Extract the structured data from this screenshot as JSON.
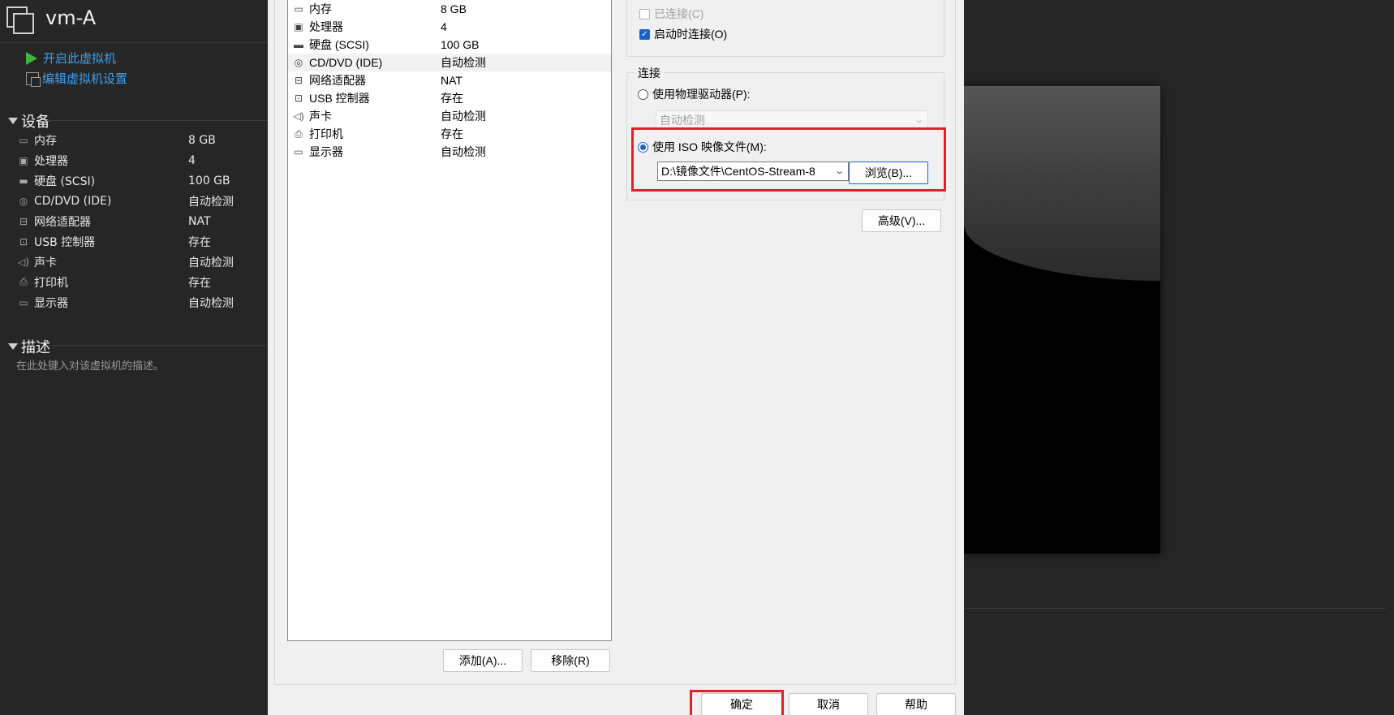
{
  "vm": {
    "title": "vm-A",
    "actions": {
      "power_on": "开启此虚拟机",
      "edit_settings": "编辑虚拟机设置"
    },
    "devices_heading": "设备",
    "devices": [
      {
        "icon": "memory-icon",
        "name": "内存",
        "value": "8 GB"
      },
      {
        "icon": "processor-icon",
        "name": "处理器",
        "value": "4"
      },
      {
        "icon": "harddisk-icon",
        "name": "硬盘 (SCSI)",
        "value": "100 GB"
      },
      {
        "icon": "cd-dvd-icon",
        "name": "CD/DVD (IDE)",
        "value": "自动检测"
      },
      {
        "icon": "network-icon",
        "name": "网络适配器",
        "value": "NAT"
      },
      {
        "icon": "usb-icon",
        "name": "USB 控制器",
        "value": "存在"
      },
      {
        "icon": "sound-icon",
        "name": "声卡",
        "value": "自动检测"
      },
      {
        "icon": "printer-icon",
        "name": "打印机",
        "value": "存在"
      },
      {
        "icon": "display-icon",
        "name": "显示器",
        "value": "自动检测"
      }
    ],
    "description_heading": "描述",
    "description_placeholder": "在此处键入对该虚拟机的描述。"
  },
  "dialog": {
    "hardware": [
      {
        "icon": "memory-icon",
        "name": "内存",
        "value": "8 GB",
        "selected": false
      },
      {
        "icon": "processor-icon",
        "name": "处理器",
        "value": "4",
        "selected": false
      },
      {
        "icon": "harddisk-icon",
        "name": "硬盘 (SCSI)",
        "value": "100 GB",
        "selected": false
      },
      {
        "icon": "cd-dvd-icon",
        "name": "CD/DVD (IDE)",
        "value": "自动检测",
        "selected": true
      },
      {
        "icon": "network-icon",
        "name": "网络适配器",
        "value": "NAT",
        "selected": false
      },
      {
        "icon": "usb-icon",
        "name": "USB 控制器",
        "value": "存在",
        "selected": false
      },
      {
        "icon": "sound-icon",
        "name": "声卡",
        "value": "自动检测",
        "selected": false
      },
      {
        "icon": "printer-icon",
        "name": "打印机",
        "value": "存在",
        "selected": false
      },
      {
        "icon": "display-icon",
        "name": "显示器",
        "value": "自动检测",
        "selected": false
      }
    ],
    "add_button": "添加(A)...",
    "remove_button": "移除(R)",
    "device_status": {
      "connected_label": "已连接(C)",
      "connected_checked": false,
      "connect_at_power_on_label": "启动时连接(O)",
      "connect_at_power_on_checked": true
    },
    "connection": {
      "group_label": "连接",
      "physical_label": "使用物理驱动器(P):",
      "physical_selected": false,
      "physical_value": "自动检测",
      "iso_label": "使用 ISO 映像文件(M):",
      "iso_selected": true,
      "iso_path": "D:\\镜像文件\\CentOS-Stream-8",
      "browse_button": "浏览(B)..."
    },
    "advanced_button": "高级(V)...",
    "ok_button": "确定",
    "cancel_button": "取消",
    "help_button": "帮助"
  },
  "colors": {
    "accent": "#1a64c8",
    "highlight": "#e0202a",
    "link": "#3ea0f0",
    "play": "#3fb53f"
  }
}
